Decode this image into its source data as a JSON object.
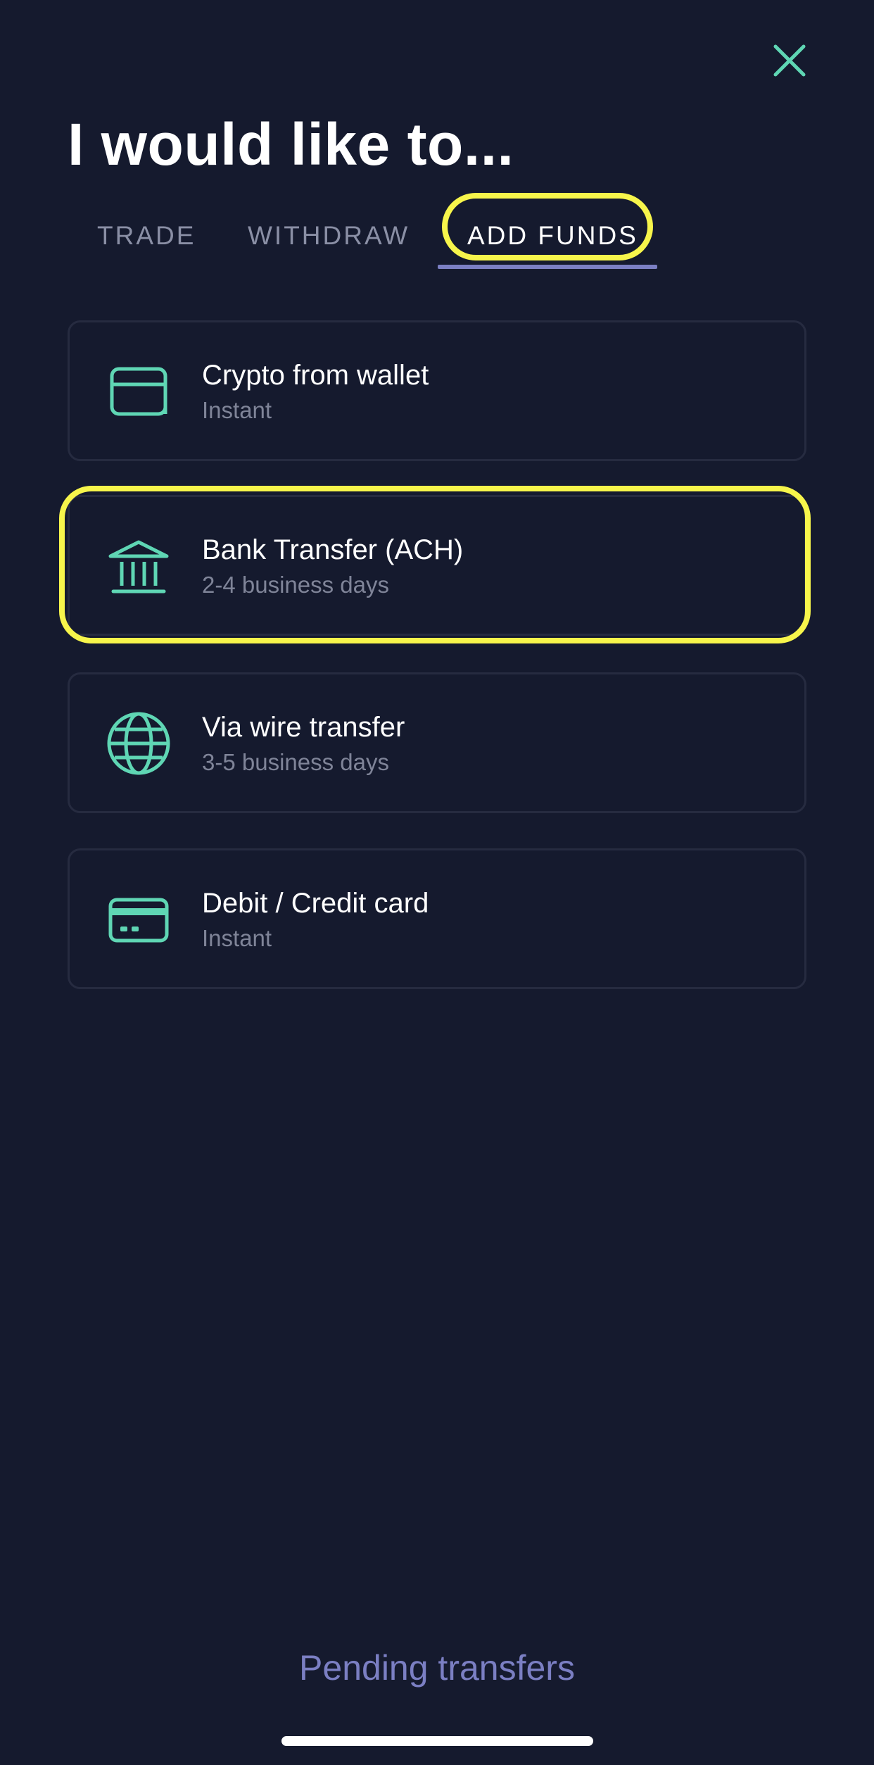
{
  "header": {
    "title": "I would like to...",
    "close_icon": "close-icon"
  },
  "tabs": [
    {
      "label": "TRADE",
      "active": false
    },
    {
      "label": "WITHDRAW",
      "active": false
    },
    {
      "label": "ADD FUNDS",
      "active": true
    }
  ],
  "options": [
    {
      "label": "Crypto from wallet",
      "sub": "Instant",
      "icon": "wallet-icon"
    },
    {
      "label": "Bank Transfer (ACH)",
      "sub": "2-4 business days",
      "icon": "bank-icon"
    },
    {
      "label": "Via wire transfer",
      "sub": "3-5 business days",
      "icon": "globe-icon"
    },
    {
      "label": "Debit / Credit card",
      "sub": "Instant",
      "icon": "credit-card-icon"
    }
  ],
  "footer": {
    "pending_label": "Pending transfers"
  },
  "colors": {
    "background": "#151a2e",
    "accent_icon": "#5fd6b4",
    "tab_underline": "#7b7fc3",
    "annotation": "#f7f54b",
    "secondary_text": "#7f8498"
  }
}
